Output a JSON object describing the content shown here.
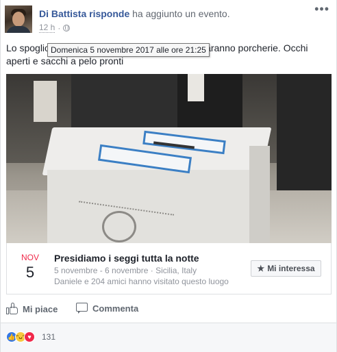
{
  "header": {
    "author": "Di Battista risponde",
    "action_text": "ha aggiunto un",
    "event_word": "evento",
    "period": ".",
    "time": "12 h",
    "more_glyph": "•••"
  },
  "tooltip": {
    "text": "Domenica 5 novembre 2017 alle ore 21:25"
  },
  "post": {
    "text_start": "Lo spoglio",
    "text_end": "tte faranno porcherie. Occhi aperti e sacchi a pelo pronti"
  },
  "event": {
    "month": "NOV",
    "day": "5",
    "title": "Presidiamo i seggi tutta la notte",
    "dates": "5 novembre - 6 novembre",
    "separator": " · ",
    "location": "Sicilia, Italy",
    "friends": "Daniele e 204 amici hanno visitato questo luogo",
    "button_label": "Mi interessa",
    "button_icon": "★"
  },
  "actions": {
    "like_label": "Mi piace",
    "comment_label": "Commenta"
  },
  "reactions": {
    "count": "131",
    "types": [
      "like",
      "haha",
      "love"
    ]
  },
  "colors": {
    "link_blue": "#365899",
    "month_red": "#f02849",
    "like_blue": "#3578e5",
    "love_red": "#f0284a",
    "haha_yellow": "#f7c93e",
    "tape_blue": "#3b7fc4"
  }
}
